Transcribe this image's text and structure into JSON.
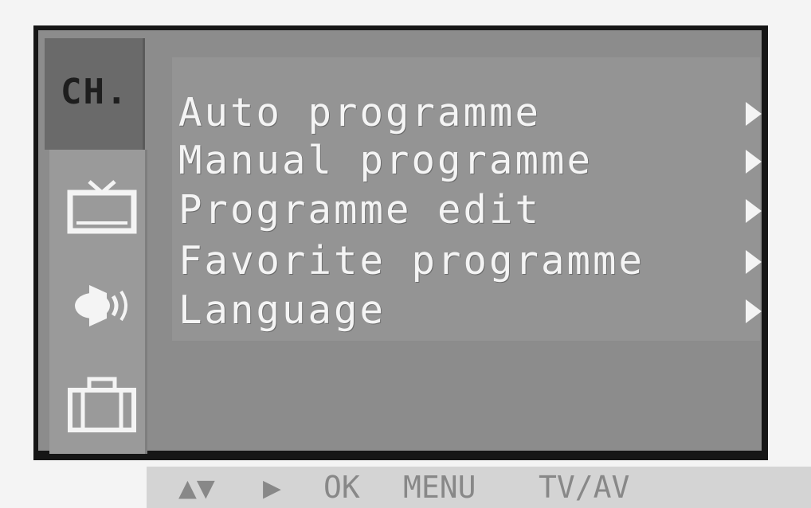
{
  "sidebar": {
    "active_tab": "CH.",
    "icons": [
      "tv-icon",
      "speaker-icon",
      "briefcase-icon"
    ]
  },
  "menu": {
    "items": [
      {
        "label": "Auto programme",
        "arrow": "right-arrow-icon"
      },
      {
        "label": "Manual programme",
        "arrow": "right-arrow-icon"
      },
      {
        "label": "Programme edit",
        "arrow": "right-arrow-icon"
      },
      {
        "label": "Favorite programme",
        "arrow": "right-arrow-icon"
      },
      {
        "label": "Language",
        "arrow": "right-arrow-icon"
      }
    ]
  },
  "helpbar": {
    "nav": "▲▼",
    "right": "▶",
    "ok": "OK",
    "menu": "MENU",
    "tv_av": "TV/AV"
  },
  "colors": {
    "frame": "#161616",
    "menu_bg": "#949494",
    "text": "#f4f4f4",
    "active_tab": "#6a6a6a",
    "helpbar_bg": "#d4d4d4"
  }
}
